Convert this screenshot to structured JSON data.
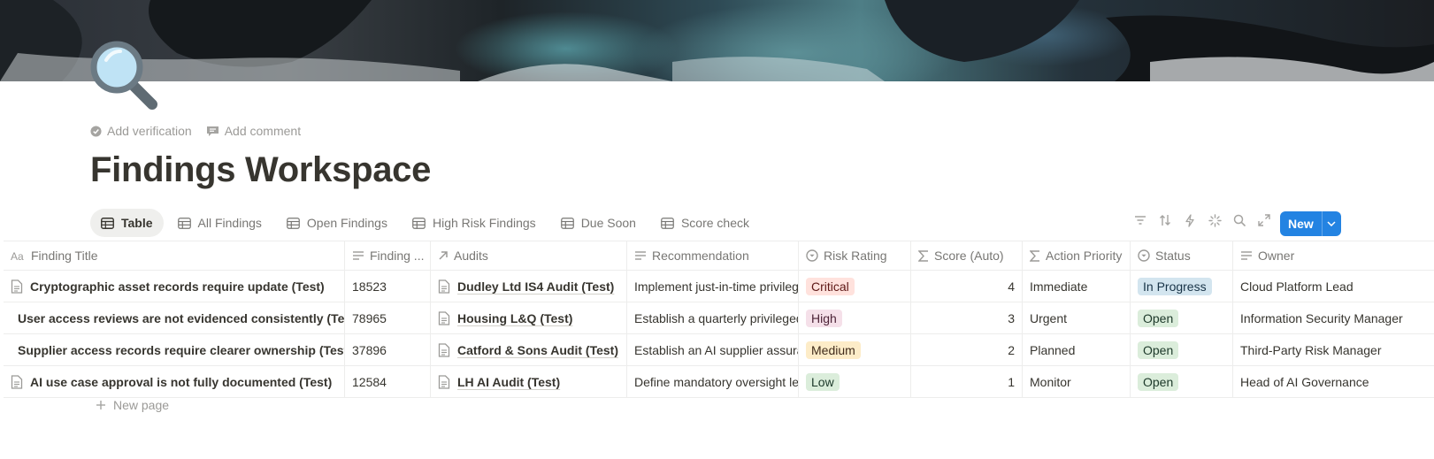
{
  "page": {
    "title": "Findings Workspace",
    "icon": "magnifying-glass-icon",
    "add_verification": "Add verification",
    "add_comment": "Add comment"
  },
  "views": [
    {
      "label": "Table",
      "icon": "table-icon",
      "active": true
    },
    {
      "label": "All Findings",
      "icon": "table-icon"
    },
    {
      "label": "Open Findings",
      "icon": "table-icon"
    },
    {
      "label": "High Risk Findings",
      "icon": "table-icon"
    },
    {
      "label": "Due Soon",
      "icon": "table-icon"
    },
    {
      "label": "Score check",
      "icon": "table-icon"
    }
  ],
  "toolbar": {
    "icons": [
      "filter-icon",
      "sort-icon",
      "automation-icon",
      "sparkle-icon",
      "search-icon",
      "expand-icon",
      "settings-icon"
    ],
    "new_label": "New",
    "accent": "#2383e2"
  },
  "columns": [
    {
      "label": "Finding Title",
      "icon": "title-icon"
    },
    {
      "label": "Finding ...",
      "icon": "text-icon"
    },
    {
      "label": "Audits",
      "icon": "relation-icon"
    },
    {
      "label": "Recommendation",
      "icon": "text-icon"
    },
    {
      "label": "Risk Rating",
      "icon": "select-icon"
    },
    {
      "label": "Score (Auto)",
      "icon": "formula-icon"
    },
    {
      "label": "Action Priority",
      "icon": "formula-icon"
    },
    {
      "label": "Status",
      "icon": "status-icon"
    },
    {
      "label": "Owner",
      "icon": "text-icon"
    }
  ],
  "rows": [
    {
      "title": "Cryptographic asset records require update (Test)",
      "finding_id": "18523",
      "audit": "Dudley Ltd IS4 Audit (Test)",
      "recommendation": "Implement just-in-time privileged access",
      "risk": "Critical",
      "score": "4",
      "priority": "Immediate",
      "status": "In Progress",
      "owner": "Cloud Platform Lead"
    },
    {
      "title": "User access reviews are not evidenced consistently (Test)",
      "finding_id": "78965",
      "audit": "Housing L&Q (Test)",
      "recommendation": "Establish a quarterly privileged access review",
      "risk": "High",
      "score": "3",
      "priority": "Urgent",
      "status": "Open",
      "owner": "Information Security Manager"
    },
    {
      "title": "Supplier access records require clearer ownership (Test)",
      "finding_id": "37896",
      "audit": "Catford & Sons Audit (Test)",
      "recommendation": "Establish an AI supplier assurance process",
      "risk": "Medium",
      "score": "2",
      "priority": "Planned",
      "status": "Open",
      "owner": "Third-Party Risk Manager"
    },
    {
      "title": "AI use case approval is not fully documented (Test)",
      "finding_id": "12584",
      "audit": "LH AI Audit (Test)",
      "recommendation": "Define mandatory oversight levels",
      "risk": "Low",
      "score": "1",
      "priority": "Monitor",
      "status": "Open",
      "owner": "Head of AI Governance"
    }
  ],
  "risk_colors": {
    "Critical": {
      "bg": "#ffe2dd",
      "fg": "#5d1715"
    },
    "High": {
      "bg": "#f5e0e9",
      "fg": "#4c2337"
    },
    "Medium": {
      "bg": "#fdecc8",
      "fg": "#402c1b"
    },
    "Low": {
      "bg": "#dbeddb",
      "fg": "#1c3829"
    }
  },
  "status_colors": {
    "In Progress": {
      "bg": "#d3e5ef",
      "fg": "#183347"
    },
    "Open": {
      "bg": "#dbeddb",
      "fg": "#1c3829"
    }
  },
  "new_page_label": "New page"
}
